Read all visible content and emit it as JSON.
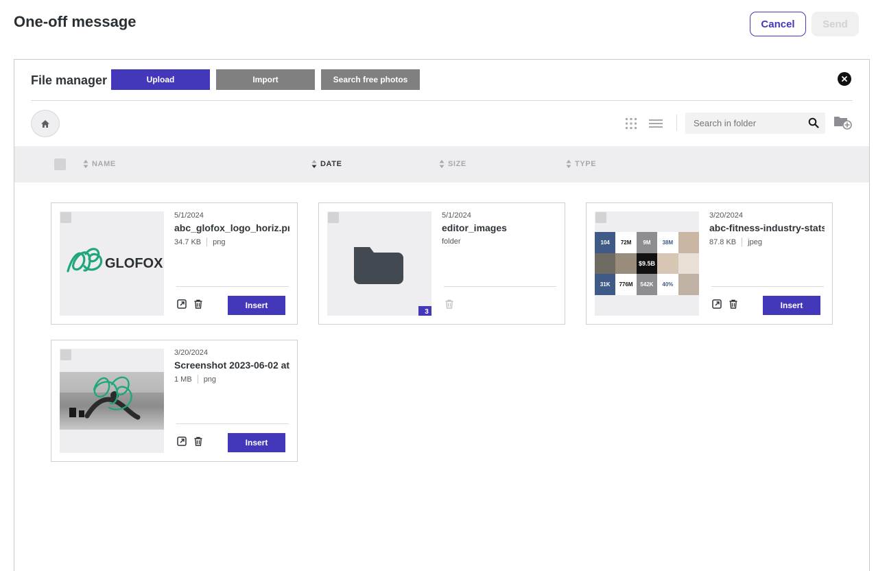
{
  "header": {
    "title": "One-off message",
    "cancel_label": "Cancel",
    "send_label": "Send"
  },
  "file_manager": {
    "title": "File manager",
    "upload_label": "Upload",
    "import_label": "Import",
    "search_photos_label": "Search free photos",
    "search_placeholder": "Search in folder"
  },
  "columns": {
    "name": "NAME",
    "date": "DATE",
    "size": "SIZE",
    "type": "TYPE",
    "active_sort": "date"
  },
  "accent_color": "#4338ba",
  "files": [
    {
      "date": "5/1/2024",
      "name": "abc_glofox_logo_horiz.png",
      "size": "34.7 KB",
      "type": "png",
      "insert_label": "Insert",
      "thumbnail": "glofox-logo"
    },
    {
      "date": "5/1/2024",
      "name": "editor_images",
      "type": "folder",
      "item_count": "3",
      "thumbnail": "folder-icon"
    },
    {
      "date": "3/20/2024",
      "name": "abc-fitness-industry-stats.jpeg",
      "size": "87.8 KB",
      "type": "jpeg",
      "insert_label": "Insert",
      "thumbnail": "infographic"
    },
    {
      "date": "3/20/2024",
      "name": "Screenshot 2023-06-02 at",
      "size": "1 MB",
      "type": "png",
      "insert_label": "Insert",
      "thumbnail": "fitness-photo"
    }
  ],
  "infographic_stats": [
    "104",
    "72M",
    "9M",
    "38M",
    "$9.5B",
    "31K",
    "776M",
    "542K",
    "40%"
  ],
  "logo_text": "GLOFOX"
}
